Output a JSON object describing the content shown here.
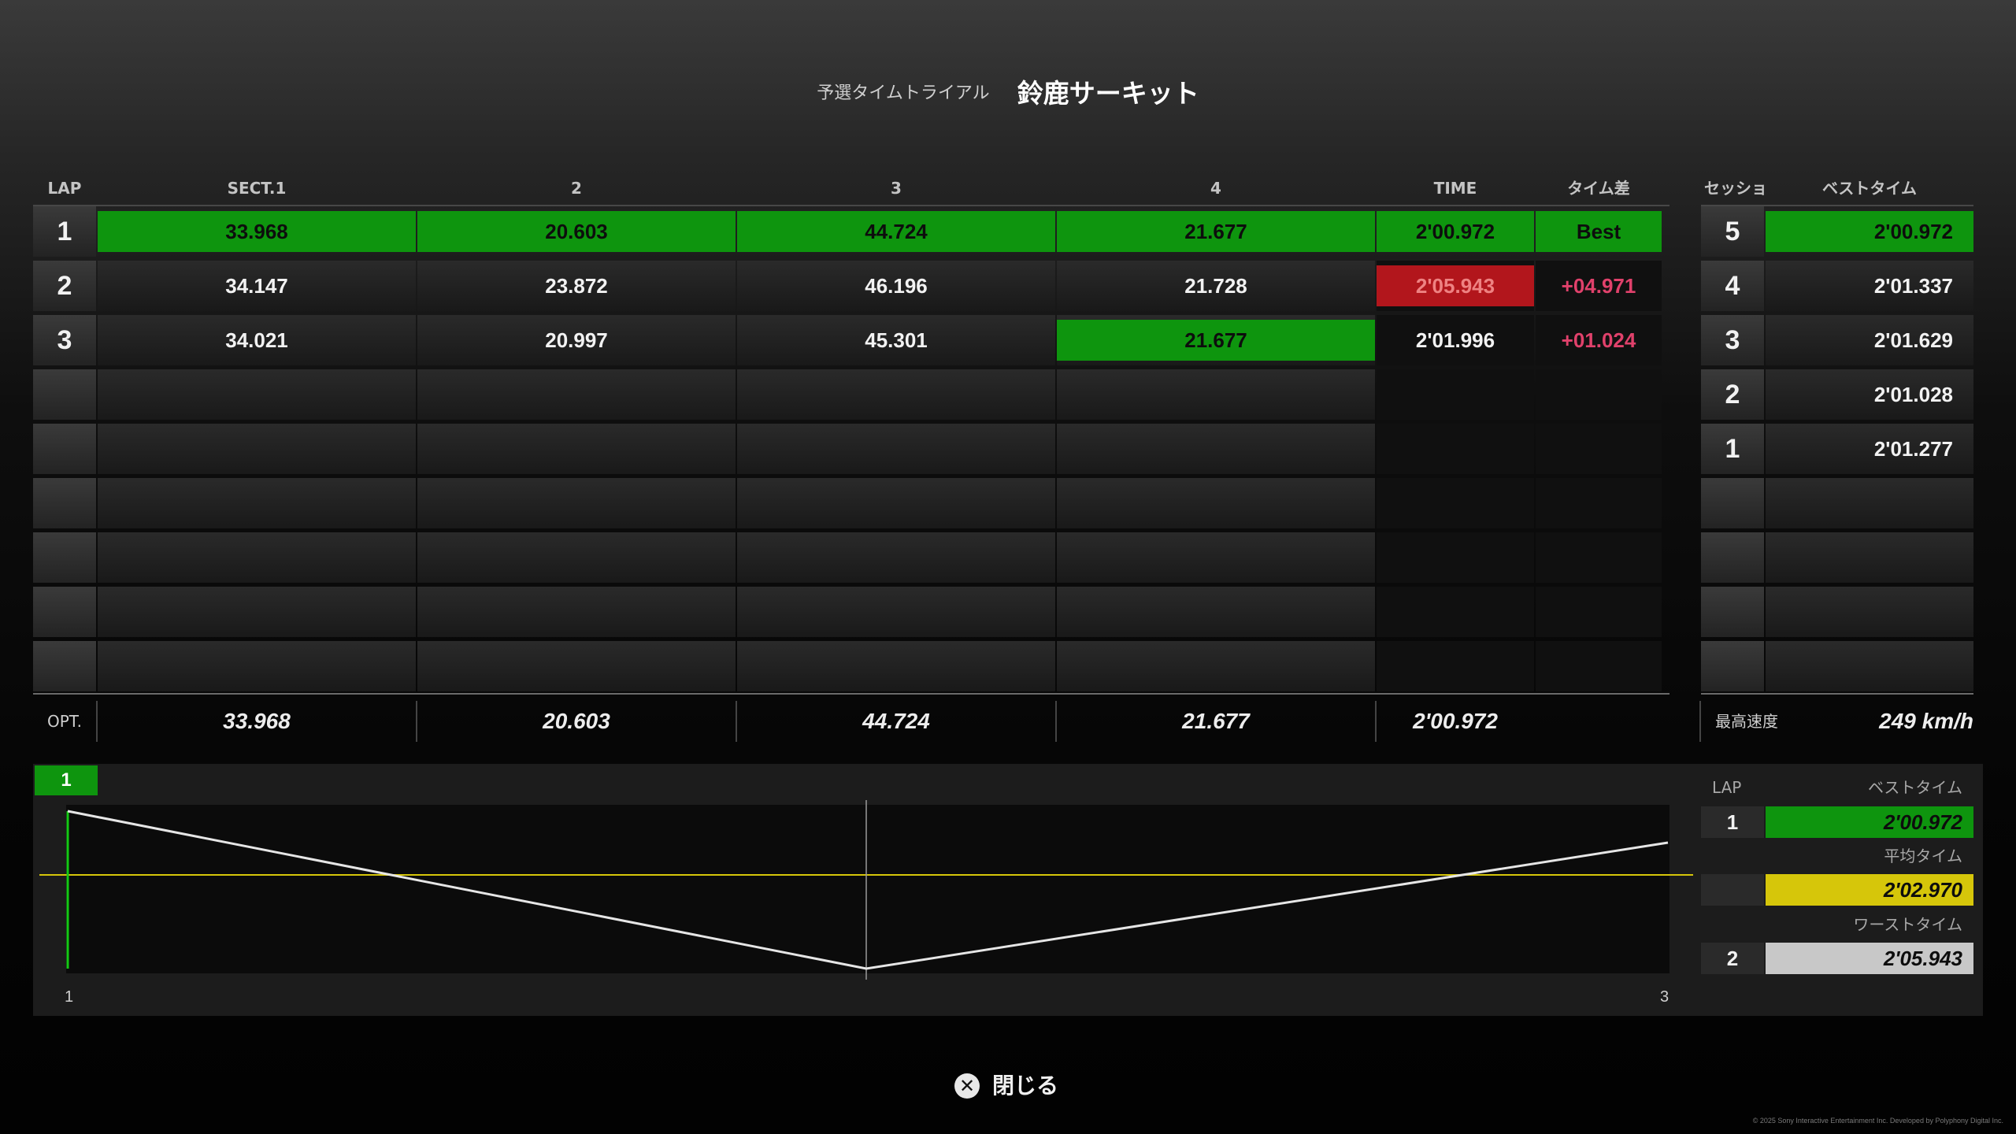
{
  "header": {
    "subtitle": "予選タイムトライアル",
    "title": "鈴鹿サーキット"
  },
  "table": {
    "columns": [
      "LAP",
      "SECT.1",
      "2",
      "3",
      "4",
      "TIME",
      "タイム差"
    ],
    "laps": [
      {
        "lap": "1",
        "sectors": [
          "33.968",
          "20.603",
          "44.724",
          "21.677"
        ],
        "time": "2'00.972",
        "diff": "Best"
      },
      {
        "lap": "2",
        "sectors": [
          "34.147",
          "23.872",
          "46.196",
          "21.728"
        ],
        "time": "2'05.943",
        "diff": "+04.971"
      },
      {
        "lap": "3",
        "sectors": [
          "34.021",
          "20.997",
          "45.301",
          "21.677"
        ],
        "time": "2'01.996",
        "diff": "+01.024"
      }
    ],
    "empty_rows": 6,
    "optimal": {
      "label": "OPT.",
      "sectors": [
        "33.968",
        "20.603",
        "44.724",
        "21.677"
      ],
      "time": "2'00.972"
    }
  },
  "session": {
    "columns": [
      "セッション",
      "ベストタイム"
    ],
    "rows": [
      {
        "session": "5",
        "best": "2'00.972"
      },
      {
        "session": "4",
        "best": "2'01.337"
      },
      {
        "session": "3",
        "best": "2'01.629"
      },
      {
        "session": "2",
        "best": "2'01.028"
      },
      {
        "session": "1",
        "best": "2'01.277"
      }
    ],
    "empty_rows": 4,
    "top_speed_label": "最高速度",
    "top_speed": "249 km/h"
  },
  "graph": {
    "selected_lap": "1",
    "x_start_label": "1",
    "x_end_label": "3",
    "series": {
      "laps": [
        1,
        2,
        3
      ],
      "times": [
        "2'00.972",
        "2'05.943",
        "2'01.996"
      ]
    },
    "average_line": "2'02.970",
    "colors": {
      "line": "#e6e6e6",
      "average": "#d6c60a",
      "best_marker": "#14c814"
    }
  },
  "summary": {
    "lap_header": "LAP",
    "best_header": "ベストタイム",
    "best_lap": "1",
    "best_time": "2'00.972",
    "avg_header": "平均タイム",
    "avg_time": "2'02.970",
    "worst_header": "ワーストタイム",
    "worst_lap": "2",
    "worst_time": "2'05.943"
  },
  "close": {
    "icon": "cross-button-icon",
    "label": "閉じる"
  },
  "footer": {
    "copyright": "© 2025 Sony Interactive Entertainment Inc. Developed by Polyphony Digital Inc."
  },
  "colors": {
    "best_green": "#0e950e",
    "worst_red": "#b2161c",
    "avg_yellow": "#d6c60a",
    "worst_gray": "#c8c8c8",
    "diff_red": "#e0416b"
  }
}
